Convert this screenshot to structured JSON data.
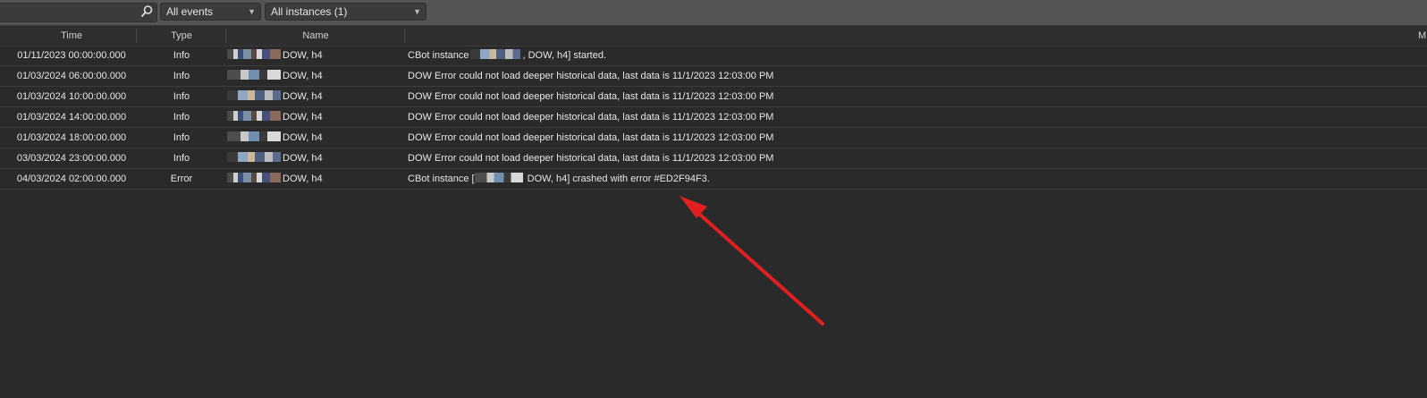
{
  "toolbar": {
    "search": {
      "value": "",
      "placeholder": ""
    },
    "event_filter": {
      "selected": "All events"
    },
    "instance_filter": {
      "selected": "All instances (1)"
    }
  },
  "columns": [
    "Time",
    "Type",
    "Name",
    "M"
  ],
  "rows": [
    {
      "time": "01/11/2023 00:00:00.000",
      "type": "Info",
      "name": "DOW, h4",
      "msg_pre": "CBot instance",
      "msg_post": ", DOW, h4] started."
    },
    {
      "time": "01/03/2024 06:00:00.000",
      "type": "Info",
      "name": "DOW, h4",
      "msg": "DOW Error could not load deeper historical data, last data is 11/1/2023 12:03:00 PM"
    },
    {
      "time": "01/03/2024 10:00:00.000",
      "type": "Info",
      "name": "DOW, h4",
      "msg": "DOW Error could not load deeper historical data, last data is 11/1/2023 12:03:00 PM"
    },
    {
      "time": "01/03/2024 14:00:00.000",
      "type": "Info",
      "name": "DOW, h4",
      "msg": "DOW Error could not load deeper historical data, last data is 11/1/2023 12:03:00 PM"
    },
    {
      "time": "01/03/2024 18:00:00.000",
      "type": "Info",
      "name": "DOW, h4",
      "msg": "DOW Error could not load deeper historical data, last data is 11/1/2023 12:03:00 PM"
    },
    {
      "time": "03/03/2024 23:00:00.000",
      "type": "Info",
      "name": "DOW, h4",
      "msg": "DOW Error could not load deeper historical data, last data is 11/1/2023 12:03:00 PM"
    },
    {
      "time": "04/03/2024 02:00:00.000",
      "type": "Error",
      "name": "DOW, h4",
      "msg_pre": "CBot instance [",
      "msg_post": " DOW, h4] crashed with error #ED2F94F3."
    }
  ],
  "annotation": {
    "arrow_color": "#e02020"
  }
}
